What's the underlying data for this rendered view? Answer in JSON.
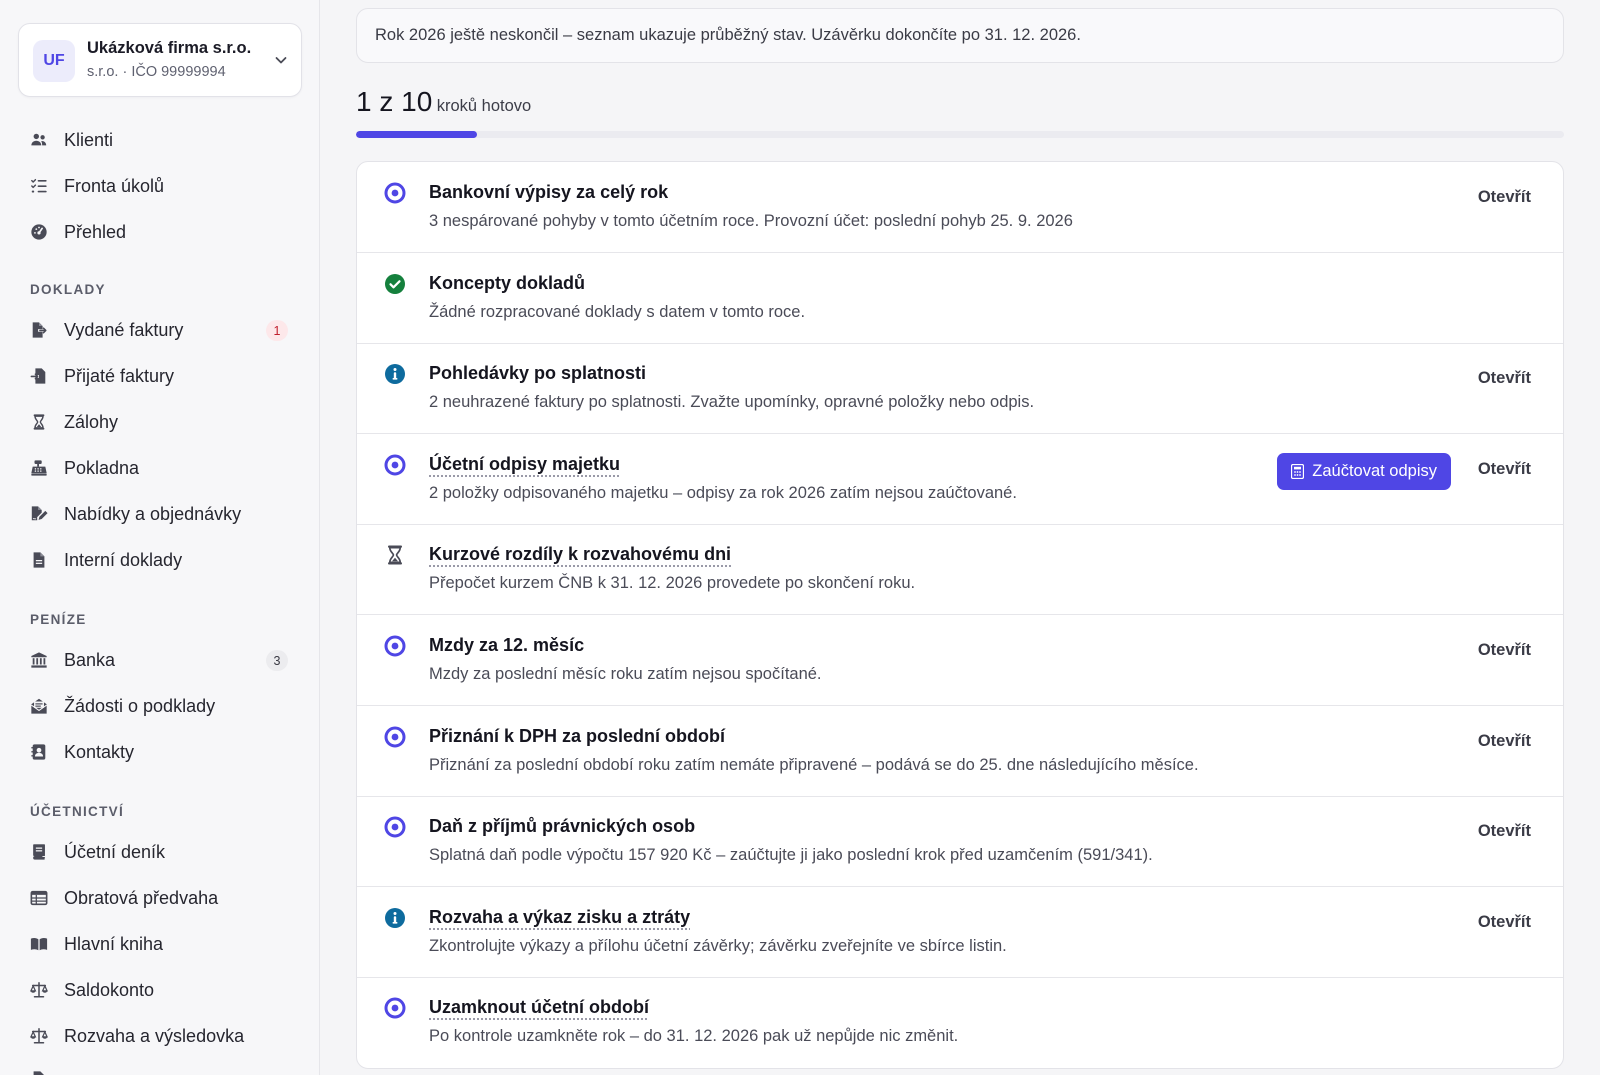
{
  "org": {
    "initials": "UF",
    "name": "Ukázková firma s.r.o.",
    "subtitle": "s.r.o. · IČO 99999994"
  },
  "sidebar": {
    "top_items": [
      {
        "label": "Klienti",
        "icon": "users-icon"
      },
      {
        "label": "Fronta úkolů",
        "icon": "task-list-icon"
      },
      {
        "label": "Přehled",
        "icon": "gauge-icon"
      }
    ],
    "sections": [
      {
        "label": "DOKLADY",
        "items": [
          {
            "label": "Vydané faktury",
            "icon": "file-export-icon",
            "badge": "1"
          },
          {
            "label": "Přijaté faktury",
            "icon": "file-import-icon"
          },
          {
            "label": "Zálohy",
            "icon": "hourglass-icon"
          },
          {
            "label": "Pokladna",
            "icon": "cash-register-icon"
          },
          {
            "label": "Nabídky a objednávky",
            "icon": "file-signature-icon"
          },
          {
            "label": "Interní doklady",
            "icon": "file-icon"
          }
        ]
      },
      {
        "label": "PENÍZE",
        "items": [
          {
            "label": "Banka",
            "icon": "bank-icon",
            "badge": "3"
          },
          {
            "label": "Žádosti o podklady",
            "icon": "envelope-open-icon"
          },
          {
            "label": "Kontakty",
            "icon": "address-book-icon"
          }
        ]
      },
      {
        "label": "ÚČETNICTVÍ",
        "items": [
          {
            "label": "Účetní deník",
            "icon": "book-icon"
          },
          {
            "label": "Obratová předvaha",
            "icon": "table-icon"
          },
          {
            "label": "Hlavní kniha",
            "icon": "book-open-icon"
          },
          {
            "label": "Saldokonto",
            "icon": "scale-icon"
          },
          {
            "label": "Rozvaha a výsledovka",
            "icon": "scale-balanced-icon"
          }
        ]
      }
    ]
  },
  "notice": "Rok 2026 ještě neskončil – seznam ukazuje průběžný stav. Uzávěrku dokončíte po 31. 12. 2026.",
  "progress": {
    "done": "1 z 10",
    "label": "kroků hotovo",
    "fraction": 0.1
  },
  "open_label": "Otevřít",
  "steps": [
    {
      "title": "Bankovní výpisy za celý rok",
      "desc": "3 nespárované pohyby v tomto účetním roce. Provozní účet: poslední pohyb 25. 9. 2026",
      "status": "pending",
      "link": true
    },
    {
      "title": "Koncepty dokladů",
      "desc": "Žádné rozpracované doklady s datem v tomto roce.",
      "status": "done",
      "link": false
    },
    {
      "title": "Pohledávky po splatnosti",
      "desc": "2 neuhrazené faktury po splatnosti. Zvažte upomínky, opravné položky nebo odpis.",
      "status": "info",
      "link": true
    },
    {
      "title": "Účetní odpisy majetku",
      "desc": "2 položky odpisovaného majetku – odpisy za rok 2026 zatím nejsou zaúčtované.",
      "status": "pending",
      "link": true,
      "dotted": true,
      "action": "Zaúčtovat odpisy"
    },
    {
      "title": "Kurzové rozdíly k rozvahovému dni",
      "desc": "Přepočet kurzem ČNB k 31. 12. 2026 provedete po skončení roku.",
      "status": "waiting",
      "link": false,
      "dotted": true
    },
    {
      "title": "Mzdy za 12. měsíc",
      "desc": "Mzdy za poslední měsíc roku zatím nejsou spočítané.",
      "status": "pending",
      "link": true
    },
    {
      "title": "Přiznání k DPH za poslední období",
      "desc": "Přiznání za poslední období roku zatím nemáte připravené – podává se do 25. dne následujícího měsíce.",
      "status": "pending",
      "link": true
    },
    {
      "title": "Daň z příjmů právnických osob",
      "desc": "Splatná daň podle výpočtu 157 920 Kč – zaúčtujte ji jako poslední krok před uzamčením (591/341).",
      "status": "pending",
      "link": true
    },
    {
      "title": "Rozvaha a výkaz zisku a ztráty",
      "desc": "Zkontrolujte výkazy a přílohu účetní závěrky; závěrku zveřejníte ve sbírce listin.",
      "status": "info",
      "link": true,
      "dotted": true
    },
    {
      "title": "Uzamknout účetní období",
      "desc": "Po kontrole uzamkněte rok – do 31. 12. 2026 pak už nepůjde nic změnit.",
      "status": "pending",
      "link": false,
      "dotted": true
    }
  ],
  "colors": {
    "accent": "#4f46e5",
    "done": "#15803d",
    "info": "#0e6b9e",
    "waiting": "#4a4b57"
  }
}
